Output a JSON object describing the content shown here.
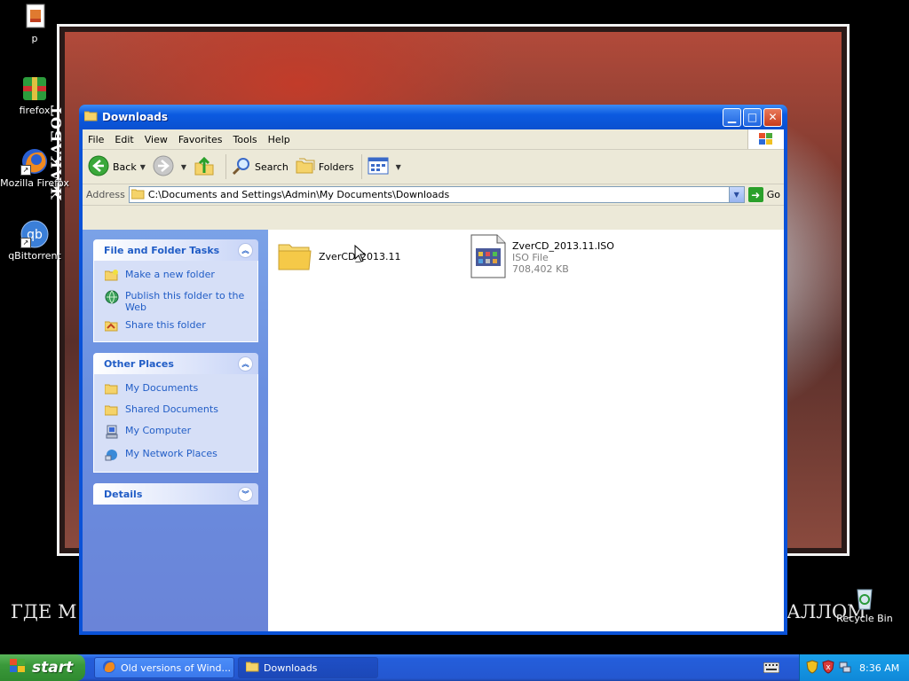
{
  "desktop": {
    "icons": [
      {
        "label": "p"
      },
      {
        "label": "firefox"
      },
      {
        "label": "Mozilla Firefox"
      },
      {
        "label": "qBittorrent"
      },
      {
        "label": "Recycle Bin"
      }
    ],
    "wallpaper_vertical_text": "ЖАКАБОТ",
    "wallpaper_caption_left": "ГДЕ М",
    "wallpaper_caption_right": "АЛЛОМ"
  },
  "window": {
    "title": "Downloads",
    "menu": [
      "File",
      "Edit",
      "View",
      "Favorites",
      "Tools",
      "Help"
    ],
    "toolbar": {
      "back": "Back",
      "search": "Search",
      "folders": "Folders"
    },
    "address": {
      "label": "Address",
      "path": "C:\\Documents and Settings\\Admin\\My Documents\\Downloads",
      "go": "Go"
    },
    "file_folder_tasks": {
      "title": "File and Folder Tasks",
      "items": [
        "Make a new folder",
        "Publish this folder to the Web",
        "Share this folder"
      ]
    },
    "other_places": {
      "title": "Other Places",
      "items": [
        "My Documents",
        "Shared Documents",
        "My Computer",
        "My Network Places"
      ]
    },
    "details": {
      "title": "Details"
    },
    "files": [
      {
        "name": "ZverCD_2013.11"
      },
      {
        "name": "ZverCD_2013.11.ISO",
        "type": "ISO File",
        "size": "708,402 KB"
      }
    ]
  },
  "taskbar": {
    "start": "start",
    "tasks": [
      {
        "label": "Old versions of Wind..."
      },
      {
        "label": "Downloads"
      }
    ],
    "clock": "8:36 AM"
  },
  "colors": {
    "titlebar": "#0a52d8",
    "taskpane": "#6a8fe0",
    "link": "#215dc6",
    "start": "#3a993a"
  }
}
